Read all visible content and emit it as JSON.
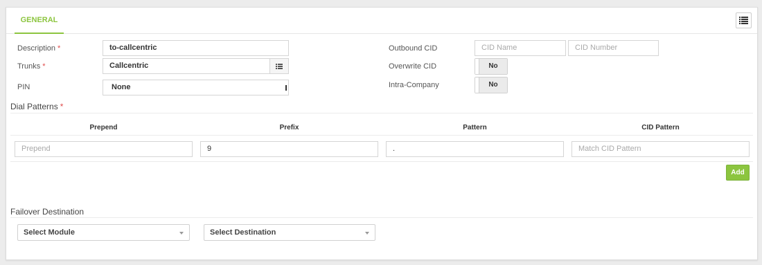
{
  "tabs": [
    {
      "label": "GENERAL",
      "active": true
    }
  ],
  "toolbar": {
    "list_icon": "list-icon"
  },
  "form": {
    "description": {
      "label": "Description",
      "required": "*",
      "value": "to-callcentric"
    },
    "trunks": {
      "label": "Trunks",
      "required": "*",
      "value": "Callcentric",
      "icon": "list-icon"
    },
    "pin": {
      "label": "PIN",
      "value": "None"
    },
    "outbound_cid": {
      "label": "Outbound CID",
      "name_placeholder": "CID Name",
      "number_placeholder": "CID Number"
    },
    "overwrite_cid": {
      "label": "Overwrite CID",
      "value": "No"
    },
    "intra_company": {
      "label": "Intra-Company",
      "value": "No"
    }
  },
  "dial_patterns": {
    "title": "Dial Patterns",
    "required": "*",
    "columns": [
      "Prepend",
      "Prefix",
      "Pattern",
      "CID Pattern"
    ],
    "row": {
      "prepend": {
        "value": "",
        "placeholder": "Prepend"
      },
      "prefix": {
        "value": "9"
      },
      "pattern": {
        "value": "."
      },
      "cid_pattern": {
        "value": "",
        "placeholder": "Match CID Pattern"
      }
    },
    "add_label": "Add"
  },
  "failover": {
    "title": "Failover Destination",
    "module_select": "Select Module",
    "destination_select": "Select Destination"
  },
  "colors": {
    "accent": "#8cc53f",
    "required": "#e04b4b"
  }
}
